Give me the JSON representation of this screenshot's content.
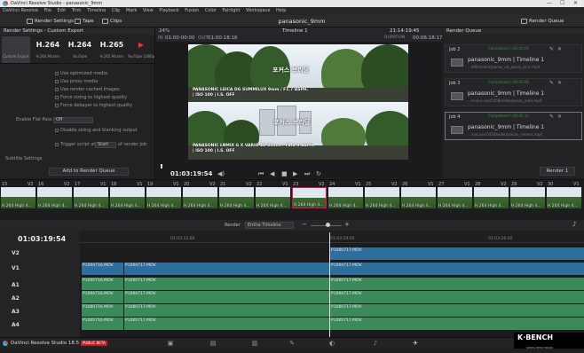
{
  "titlebar": {
    "title": "DaVinci Resolve Studio - panasonic_9mm",
    "controls": [
      "—",
      "☐",
      "✕"
    ]
  },
  "menu": [
    "DaVinci Resolve",
    "File",
    "Edit",
    "Trim",
    "Timeline",
    "Clip",
    "Mark",
    "View",
    "Playback",
    "Fusion",
    "Color",
    "Fairlight",
    "Workspace",
    "Help"
  ],
  "toolbar": {
    "render_settings": "Render Settings",
    "tape": "Tape",
    "clips": "Clips",
    "project": "panasonic_9mm",
    "render_queue": "Render Queue"
  },
  "render_settings": {
    "header": "Render Settings - Custom Export",
    "presets": [
      {
        "value": "",
        "label": "Custom Export"
      },
      {
        "value": "H.264",
        "label": "H.264 Master"
      },
      {
        "value": "H.264",
        "label": "YouTube"
      },
      {
        "value": "H.265",
        "label": "H.265 Master"
      },
      {
        "value": "▶",
        "label": "YouTube 1080p"
      }
    ],
    "options": [
      "Use optimized media",
      "Use proxy media",
      "Use render cached images",
      "Force sizing to highest quality",
      "Force debayer to highest quality"
    ],
    "flat_pass_label": "Enable Flat Pass",
    "flat_pass_value": "Off",
    "disable_sizing": "Disable sizing and blanking output",
    "trigger_label": "Trigger script at",
    "trigger_value": "Start",
    "trigger_suffix": "of render job",
    "subtitle_settings": "Subtitle Settings",
    "add_to_queue": "Add to Render Queue"
  },
  "viewer": {
    "zoom": "24%",
    "timeline": "Timeline 1",
    "in_label": "IN",
    "in_tc": "01:00:00:00",
    "out_label": "OUT",
    "out_tc": "01:00:18:16",
    "tc_right": "21:14:19:45",
    "duration_label": "DURATION",
    "duration": "00:06:18:17",
    "top_overlay": "포커스 브리딩",
    "top_caption1": "PANASONIC LEICA DG SUMMILUX 9mm / F1.7 ASPH.",
    "top_caption2": "| ISO 100 | I.S. OFF",
    "bottom_overlay": "포커스 브리딩",
    "bottom_caption1": "PANASONIC LUMIX G X VARIO 12-35mm / F2.8 II ASPH.",
    "bottom_caption2": "| ISO 100 | I.S. OFF",
    "current_tc": "01:03:19:54"
  },
  "render_queue": {
    "header": "Render Queue",
    "jobs": [
      {
        "id": "Job 2",
        "progress": "Completed in 00:02:09",
        "title": "panasonic_9mm | Timeline 1",
        "file": "...d90/videos/panas_nic_quick_sync.mp4"
      },
      {
        "id": "Job 3",
        "progress": "Completed in 00:02:06",
        "title": "panasonic_9mm | Timeline 1",
        "file": "...nvoin/.user5458/video/panas_auto.mp4"
      },
      {
        "id": "Job 4",
        "progress": "Completed in 00:02:11",
        "title": "panasonic_9mm | Timeline 1",
        "file": "...nan.user5458/video/panas_nvhevc.mp4"
      }
    ],
    "render_all": "Render 1"
  },
  "clips": [
    {
      "num": "15",
      "track": "V2",
      "label": "H.264 High 4..."
    },
    {
      "num": "16",
      "track": "V2",
      "label": "H.264 High 4..."
    },
    {
      "num": "17",
      "track": "V1",
      "label": "H.264 High 4..."
    },
    {
      "num": "18",
      "track": "V1",
      "label": "H.264 High 4..."
    },
    {
      "num": "19",
      "track": "V1",
      "label": "H.264 High 4..."
    },
    {
      "num": "20",
      "track": "V2",
      "label": "H.264 High 4..."
    },
    {
      "num": "21",
      "track": "V2",
      "label": "H.264 High 4..."
    },
    {
      "num": "22",
      "track": "V1",
      "label": "H.264 High 4..."
    },
    {
      "num": "23",
      "track": "V2",
      "label": "H.264 High 4..."
    },
    {
      "num": "24",
      "track": "V1",
      "label": "H.264 High 4..."
    },
    {
      "num": "25",
      "track": "V2",
      "label": "H.264 High 4..."
    },
    {
      "num": "26",
      "track": "V1",
      "label": "H.264 High 4..."
    },
    {
      "num": "27",
      "track": "V1",
      "label": "H.264 High 4..."
    },
    {
      "num": "28",
      "track": "V2",
      "label": "H.264 High 4..."
    },
    {
      "num": "29",
      "track": "V2",
      "label": "H.264 High 4..."
    },
    {
      "num": "30",
      "track": "V1",
      "label": "H.264 High 4..."
    }
  ],
  "timeline": {
    "render_label": "Render",
    "render_range": "Entire Timeline",
    "current_tc": "01:03:19:54",
    "ruler": [
      "01:03:12:00",
      "01:03:19:00",
      "01:03:26:00"
    ],
    "tracks": [
      "V2",
      "V1",
      "A1",
      "A2",
      "A3",
      "A4"
    ],
    "v2_clip": "P1000717.MOV",
    "v1_clips": [
      "P1000716.MOV",
      "P1000717.MOV",
      "P1000717.MOV"
    ],
    "a_clips": [
      "P1000716.MOV",
      "P1000717.MOV",
      "P1000717.MOV"
    ]
  },
  "bottom": {
    "app": "DaVinci Resolve Studio 18.5",
    "badge": "PUBLIC BETA",
    "pages": [
      "▣",
      "▤",
      "▥",
      "◧",
      "✎",
      "◐",
      "♪",
      "✈"
    ]
  },
  "watermark": {
    "brand": "K·BENCH",
    "sub": "KOREA BENCHMARK"
  },
  "colors": {
    "video": "#2f6f9e",
    "audio": "#3a8a5a",
    "accent": "#e14444"
  }
}
